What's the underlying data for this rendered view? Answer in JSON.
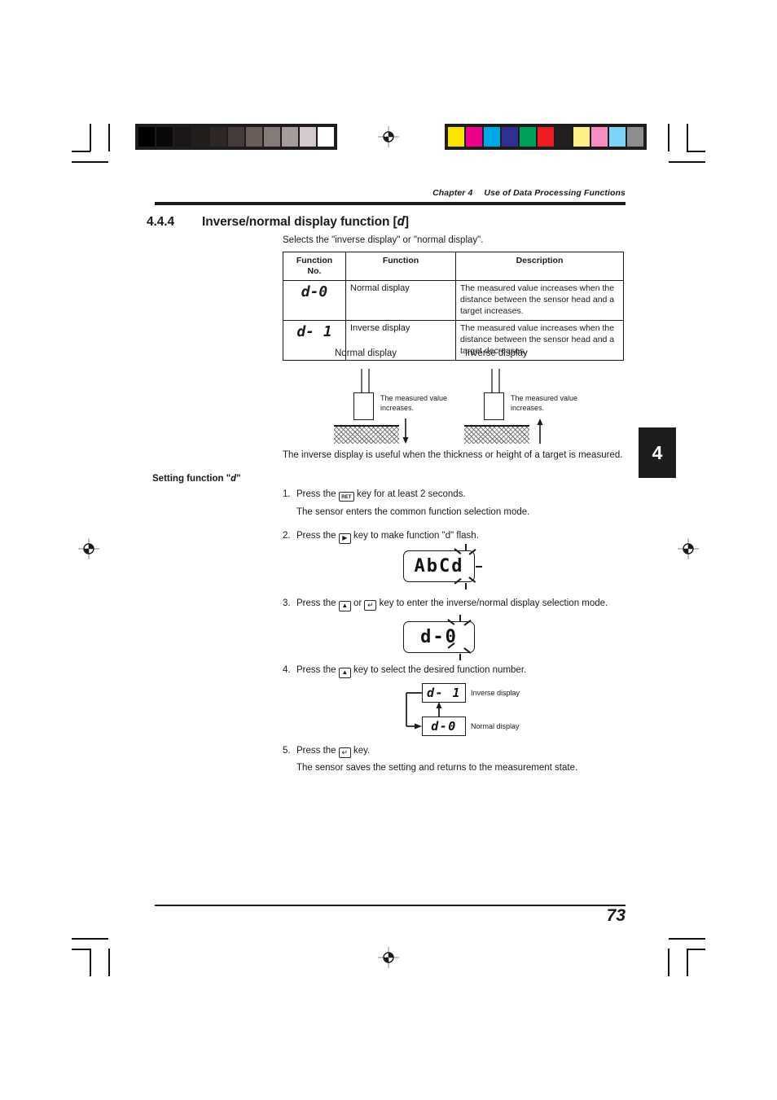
{
  "document": {
    "running_head_chapter": "Chapter 4",
    "running_head_title": "Use of Data Processing Functions",
    "page_number": "73",
    "chapter_tab": "4"
  },
  "section": {
    "number": "4.4.4",
    "title_prefix": "Inverse/normal display function [",
    "title_code": "d",
    "title_suffix": "]",
    "intro": "Selects the \"inverse display\" or \"normal display\"."
  },
  "table": {
    "headers": [
      "Function\nNo.",
      "Function",
      "Description"
    ],
    "header_no_line1": "Function",
    "header_no_line2": "No.",
    "header_function": "Function",
    "header_description": "Description",
    "rows": [
      {
        "no": "d-0",
        "function": "Normal display",
        "description": "The measured value increases when the distance between the sensor head and a target increases."
      },
      {
        "no": "d- 1",
        "function": "Inverse display",
        "description": "The measured value increases when the distance between the sensor head and a target decreases."
      }
    ]
  },
  "diagram": {
    "normal_label": "Normal display",
    "inverse_label": "Inverse display",
    "normal_note": "The measured value increases.",
    "inverse_note": "The measured value increases.",
    "normal_arrow": "down-arrow",
    "inverse_arrow": "up-arrow"
  },
  "body": {
    "useful_note": "The inverse display is useful when the thickness or height of a target is measured.",
    "setting_heading_prefix": "Setting function \"",
    "setting_heading_code": "d",
    "setting_heading_suffix": "\""
  },
  "steps": [
    {
      "number": "1.",
      "text_before": "Press the",
      "key": "RET",
      "key_name": "ret-key",
      "text_after": "key for at least 2 seconds.",
      "result": "The sensor enters the common function selection mode."
    },
    {
      "number": "2.",
      "text_before": "Press the",
      "key": "▶",
      "key_name": "right-arrow-key",
      "text_after": "key to make function \"d\" flash.",
      "result": ""
    },
    {
      "number": "3.",
      "text_before": "Press the",
      "key": "▲",
      "key_name": "up-arrow-key",
      "text_middle": "or",
      "key2": "↵",
      "key2_name": "enter-key",
      "text_after": "key to enter the inverse/normal display selection mode.",
      "result": ""
    },
    {
      "number": "4.",
      "text_before": "Press the",
      "key": "▲",
      "key_name": "up-arrow-key",
      "text_after": "key to select the desired function number.",
      "result": ""
    },
    {
      "number": "5.",
      "text_before": "Press the",
      "key": "↵",
      "key_name": "enter-key",
      "text_after": "key.",
      "result": "The sensor saves the setting and returns to the measurement state."
    }
  ],
  "lcd_displays": {
    "step2": {
      "text": "AbCd",
      "flashing_char": "d"
    },
    "step3": {
      "text": "d-0",
      "flashing_char": "0"
    }
  },
  "cycle": {
    "top": {
      "code": "d- 1",
      "label": "Inverse display"
    },
    "bottom": {
      "code": "d-0",
      "label": "Normal display"
    }
  },
  "calibration": {
    "grayscale": [
      "#000000",
      "#0b0809",
      "#1a1616",
      "#231d1c",
      "#2e2725",
      "#453c39",
      "#6a5e5a",
      "#857a76",
      "#a59c99",
      "#d3c9c7",
      "#ffffff"
    ],
    "colors": [
      "#fbe400",
      "#ec0089",
      "#00a7e6",
      "#2e3192",
      "#00a159",
      "#ed1c24",
      "#231f20",
      "#fdef8a",
      "#f58cc2",
      "#7fd4f5",
      "#8c8c8c"
    ]
  }
}
